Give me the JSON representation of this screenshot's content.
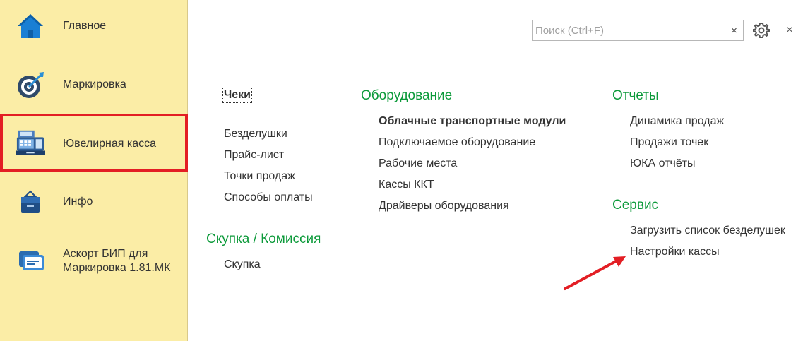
{
  "sidebar": {
    "items": [
      {
        "label": "Главное",
        "icon": "home-icon"
      },
      {
        "label": "Маркировка",
        "icon": "target-icon"
      },
      {
        "label": "Ювелирная касса",
        "icon": "cash-register-icon",
        "selected": true
      },
      {
        "label": "Инфо",
        "icon": "briefcase-icon"
      },
      {
        "label_line1": "Аскорт БИП для",
        "label_line2": "Маркировка 1.81.МК",
        "icon": "message-icon"
      }
    ]
  },
  "header": {
    "search_placeholder": "Поиск (Ctrl+F)",
    "clear_symbol": "×",
    "close_symbol": "×"
  },
  "content": {
    "col1": {
      "links": [
        "Чеки",
        "Безделушки",
        "Прайс-лист",
        "Точки продаж",
        "Способы оплаты"
      ],
      "group2_title": "Скупка / Комиссия",
      "group2_links": [
        "Скупка"
      ]
    },
    "col2": {
      "title": "Оборудование",
      "links": [
        "Облачные транспортные модули",
        "Подключаемое оборудование",
        "Рабочие места",
        "Кассы ККТ",
        "Драйверы оборудования"
      ]
    },
    "col3": {
      "title": "Отчеты",
      "links": [
        "Динамика продаж",
        "Продажи точек",
        "ЮКА отчёты"
      ],
      "group2_title": "Сервис",
      "group2_links": [
        "Загрузить список безделушек",
        "Настройки кассы"
      ]
    }
  },
  "colors": {
    "sidebar_bg": "#fbeda6",
    "group_title": "#0c9a3a",
    "highlight": "#e31e24"
  }
}
